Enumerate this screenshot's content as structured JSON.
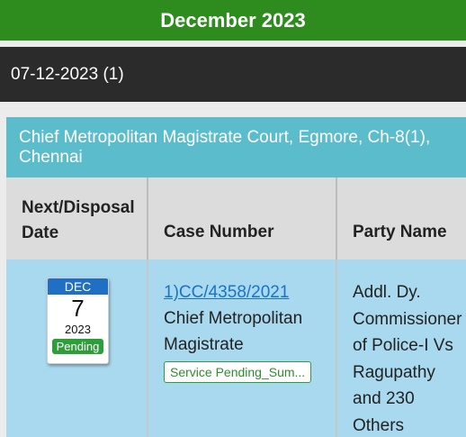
{
  "header": {
    "month_title": "December 2023"
  },
  "date_group": {
    "label": "07-12-2023 (1)"
  },
  "court": {
    "name": "Chief Metropolitan Magistrate Court, Egmore, Ch-8(1), Chennai"
  },
  "table": {
    "columns": [
      "Next/Disposal Date",
      "Case Number",
      "Party Name"
    ],
    "rows": [
      {
        "calendar": {
          "month": "DEC",
          "day": "7",
          "year": "2023",
          "status": "Pending"
        },
        "case_number": "1)CC/4358/2021",
        "court_name": "Chief Metropolitan Magistrate",
        "stage_badge": "Service Pending_Sum...",
        "party_lines": [
          "Addl. Dy.",
          "Commissioner",
          "of Police-I Vs",
          "Ragupathy",
          "and 230",
          "Others"
        ]
      }
    ]
  },
  "colors": {
    "month_bar": "#2e8b1e",
    "date_bar": "#2b2b2b",
    "court_header": "#5bbccb",
    "row_background": "#a9d9ee",
    "calendar_month": "#1f6fc5",
    "status_green": "#2e9e3a",
    "link": "#1a73c7"
  }
}
